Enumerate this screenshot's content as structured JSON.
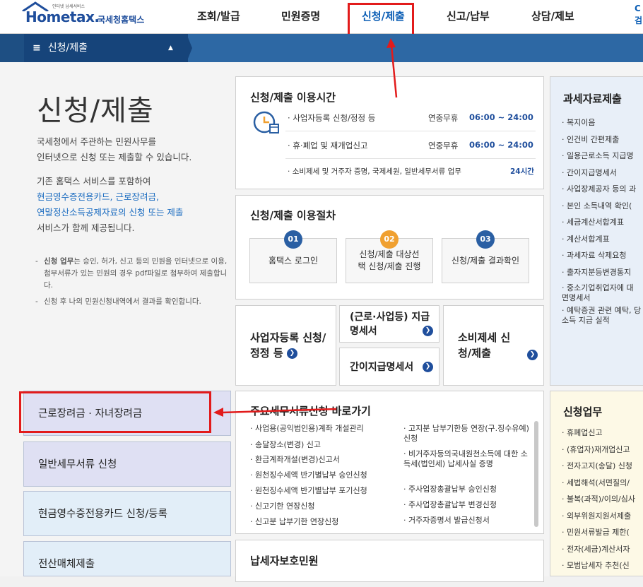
{
  "header": {
    "logo_sup": "인터넷 납세서비스",
    "logo_text": "Hometax.",
    "logo_kr": "국세청홈택스",
    "menu": [
      "조회/발급",
      "민원증명",
      "신청/제출",
      "신고/납부",
      "상담/제보"
    ],
    "corner": "C 검"
  },
  "subbar": {
    "breadcrumb": "신청/제출",
    "menu_icon": "≡",
    "collapse_icon": "▲"
  },
  "intro": {
    "title": "신청/제출",
    "desc1": "국세청에서 주관하는 민원사무를",
    "desc2": "인터넷으로 신청 또는 제출할 수 있습니다.",
    "desc3": "기존 홈택스 서비스를 포함하여",
    "desc4": "현금영수증전용카드, 근로장려금,",
    "desc5": "연말정산소득공제자료의 신청 또는 제출",
    "desc6": "서비스가 함께 제공됩니다.",
    "note1_bold": "신청 업무",
    "note1": "는 승인, 허가, 신고 등의 민원을 인터넷으로 이용, 첨부서류가 있는 민원의 경우 pdf파일로 첨부하여 제출합니다.",
    "note2": "신청 후 나의 민원신청내역에서 결과를 확인합니다."
  },
  "hours": {
    "title": "신청/제출 이용시간",
    "rows": [
      {
        "name": "사업자등록 신청/정정 등",
        "label": "연중무휴",
        "time": "06:00 ~ 24:00"
      },
      {
        "name": "휴·폐업 및 재개업신고",
        "label": "연중무휴",
        "time": "06:00 ~ 24:00"
      },
      {
        "name": "소비제세 및 거주자 증명, 국제세원, 일반세무서류 업무",
        "label": "",
        "time": "24시간"
      }
    ]
  },
  "procedure": {
    "title": "신청/제출 이용절차",
    "steps": [
      {
        "num": "01",
        "label": "홈택스 로그인",
        "color": "#2a5fa3"
      },
      {
        "num": "02",
        "label": "신청/제출 대상선택 신청/제출 진행",
        "color": "#f0a030"
      },
      {
        "num": "03",
        "label": "신청/제출 결과확인",
        "color": "#2a5fa3"
      }
    ]
  },
  "quick": {
    "biz": "사업자등록 신청/정정 등",
    "pay": "(근로·사업등) 지급명세서",
    "simple": "간이지급명세서",
    "consume": "소비제세 신청/제출"
  },
  "tax_data": {
    "title": "과세자료제출",
    "items": [
      "복지이음",
      "인건비 간편제출",
      "일용근로소득 지급명",
      "간이지급명세서",
      "사업장제공자 등의 과",
      "본인 소득내역 확인(",
      "세금계산서합계표",
      "계산서합계표",
      "과세자료 삭제요청",
      "출자지분등변경통지",
      "중소기업취업자에 대 면명세서",
      "예탁증권 관련 예탁, 당소득 지급 실적"
    ]
  },
  "apply": {
    "title": "신청업무",
    "items": [
      "휴폐업신고",
      "(휴업자)재개업신고",
      "전자고지(송달) 신청",
      "세법해석(서면질의/",
      "불복(과적)/이의/심사",
      "외부위원지원서제출",
      "민원서류발급 제한(",
      "전자(세금)계산서자",
      "모범납세자 추천(신"
    ]
  },
  "tiles": [
    "근로장려금 · 자녀장려금",
    "일반세무서류 신청",
    "현금영수증전용카드 신청/등록",
    "전산매체제출"
  ],
  "shortcuts": {
    "title": "주요세무서류신청 바로가기",
    "left": [
      "사업용(공익법인용)계좌 개설관리",
      "송달장소(변경) 신고",
      "환급계좌개설(변경)신고서",
      "원천징수세액 반기별납부 승인신청",
      "원천징수세액 반기별납부 포기신청",
      "신고기한 연장신청",
      "신고분 납부기한 연장신청"
    ],
    "right": [
      "고지분 납부기한등 연장(구.징수유예) 신청",
      "비거주자등의국내원천소득에 대한 소득세(법인세) 납세사실 증명",
      "주사업장총괄납부 승인신청",
      "주사업장총괄납부 변경신청",
      "거주자증명서 발급신청서"
    ]
  },
  "protect": {
    "title": "납세자보호민원"
  },
  "colors": {
    "accent": "#1f4e9c",
    "highlight": "#e21b1b",
    "bar": "#2d68a4"
  }
}
